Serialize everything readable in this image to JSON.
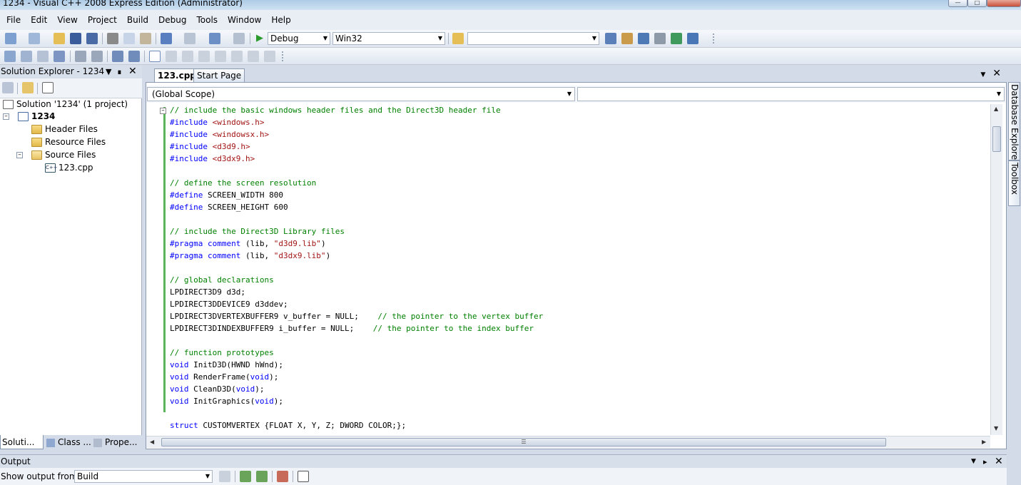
{
  "window": {
    "title": "1234 - Visual C++ 2008 Express Edition (Administrator)"
  },
  "menu": [
    "File",
    "Edit",
    "View",
    "Project",
    "Build",
    "Debug",
    "Tools",
    "Window",
    "Help"
  ],
  "toolbar": {
    "config": "Debug",
    "platform": "Win32",
    "find_value": ""
  },
  "solution_explorer": {
    "title": "Solution Explorer - 1234",
    "tree": {
      "solution": "Solution '1234' (1 project)",
      "project": "1234",
      "header_files": "Header Files",
      "resource_files": "Resource Files",
      "source_files": "Source Files",
      "file": "123.cpp",
      "file_icon_text": "C++"
    },
    "bottom_tabs": [
      "Soluti...",
      "Class ...",
      "Prope..."
    ]
  },
  "editor": {
    "tabs": [
      "123.cpp",
      "Start Page"
    ],
    "scope": "(Global Scope)",
    "member": ""
  },
  "code": [
    [
      [
        "cm",
        "// include the basic windows header files and the Direct3D header file"
      ]
    ],
    [
      [
        "kw",
        "#include"
      ],
      [
        "t",
        " "
      ],
      [
        "st",
        "<windows.h>"
      ]
    ],
    [
      [
        "kw",
        "#include"
      ],
      [
        "t",
        " "
      ],
      [
        "st",
        "<windowsx.h>"
      ]
    ],
    [
      [
        "kw",
        "#include"
      ],
      [
        "t",
        " "
      ],
      [
        "st",
        "<d3d9.h>"
      ]
    ],
    [
      [
        "kw",
        "#include"
      ],
      [
        "t",
        " "
      ],
      [
        "st",
        "<d3dx9.h>"
      ]
    ],
    [],
    [
      [
        "cm",
        "// define the screen resolution"
      ]
    ],
    [
      [
        "kw",
        "#define"
      ],
      [
        "t",
        " SCREEN_WIDTH 800"
      ]
    ],
    [
      [
        "kw",
        "#define"
      ],
      [
        "t",
        " SCREEN_HEIGHT 600"
      ]
    ],
    [],
    [
      [
        "cm",
        "// include the Direct3D Library files"
      ]
    ],
    [
      [
        "kw",
        "#pragma"
      ],
      [
        "t",
        " "
      ],
      [
        "kw",
        "comment"
      ],
      [
        "t",
        " (lib, "
      ],
      [
        "st",
        "\"d3d9.lib\""
      ],
      [
        "t",
        ")"
      ]
    ],
    [
      [
        "kw",
        "#pragma"
      ],
      [
        "t",
        " "
      ],
      [
        "kw",
        "comment"
      ],
      [
        "t",
        " (lib, "
      ],
      [
        "st",
        "\"d3dx9.lib\""
      ],
      [
        "t",
        ")"
      ]
    ],
    [],
    [
      [
        "cm",
        "// global declarations"
      ]
    ],
    [
      [
        "t",
        "LPDIRECT3D9 d3d;"
      ]
    ],
    [
      [
        "t",
        "LPDIRECT3DDEVICE9 d3ddev;"
      ]
    ],
    [
      [
        "t",
        "LPDIRECT3DVERTEXBUFFER9 v_buffer = NULL;    "
      ],
      [
        "cm",
        "// the pointer to the vertex buffer"
      ]
    ],
    [
      [
        "t",
        "LPDIRECT3DINDEXBUFFER9 i_buffer = NULL;    "
      ],
      [
        "cm",
        "// the pointer to the index buffer"
      ]
    ],
    [],
    [
      [
        "cm",
        "// function prototypes"
      ]
    ],
    [
      [
        "kw",
        "void"
      ],
      [
        "t",
        " InitD3D(HWND hWnd);"
      ]
    ],
    [
      [
        "kw",
        "void"
      ],
      [
        "t",
        " RenderFrame("
      ],
      [
        "kw",
        "void"
      ],
      [
        "t",
        ");"
      ]
    ],
    [
      [
        "kw",
        "void"
      ],
      [
        "t",
        " CleanD3D("
      ],
      [
        "kw",
        "void"
      ],
      [
        "t",
        ");"
      ]
    ],
    [
      [
        "kw",
        "void"
      ],
      [
        "t",
        " InitGraphics("
      ],
      [
        "kw",
        "void"
      ],
      [
        "t",
        ");"
      ]
    ],
    [],
    [
      [
        "kw",
        "struct"
      ],
      [
        "t",
        " CUSTOMVERTEX {FLOAT X, Y, Z; DWORD COLOR;};"
      ]
    ]
  ],
  "side_tabs": [
    "Database Explorer",
    "Toolbox"
  ],
  "output": {
    "title": "Output",
    "show_from_label": "Show output from:",
    "source": "Build"
  }
}
